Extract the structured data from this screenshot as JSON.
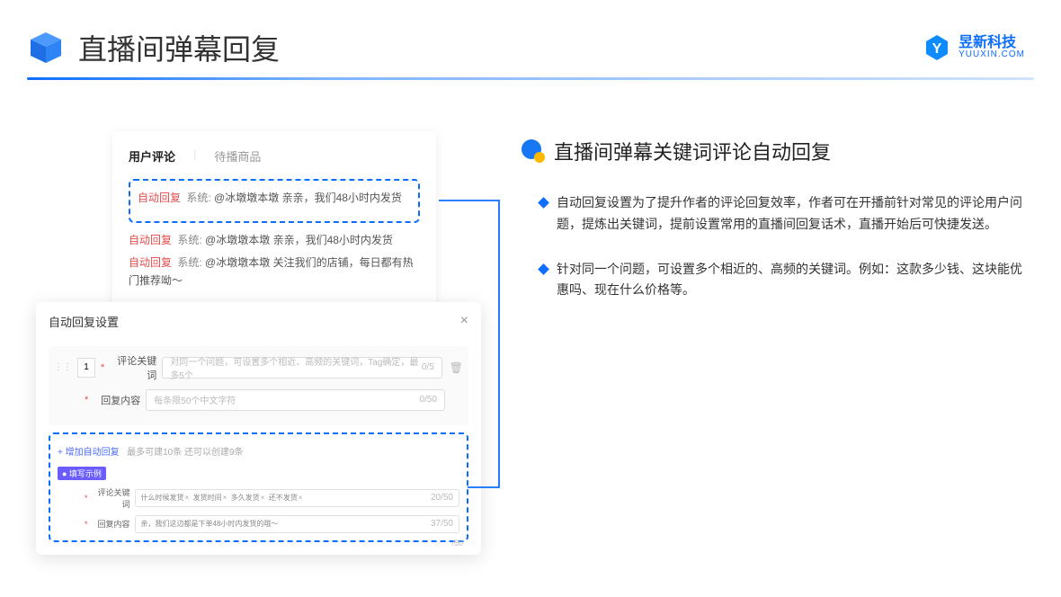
{
  "header": {
    "title": "直播间弹幕回复",
    "brand_cn": "昱新科技",
    "brand_en": "YUUXIN.COM"
  },
  "comments_card": {
    "tab_active": "用户评论",
    "tab_inactive": "待播商品",
    "highlighted": {
      "tag": "自动回复",
      "prefix": "系统:",
      "text": "@冰墩墩本墩 亲亲，我们48小时内发货"
    },
    "rows": [
      {
        "tag": "自动回复",
        "prefix": "系统:",
        "text": "@冰墩墩本墩 亲亲，我们48小时内发货"
      },
      {
        "tag": "自动回复",
        "prefix": "系统:",
        "text": "@冰墩墩本墩 关注我们的店铺，每日都有热门推荐呦～"
      }
    ]
  },
  "settings_card": {
    "title": "自动回复设置",
    "index": "1",
    "label_keyword": "评论关键词",
    "placeholder_keyword": "对同一个问题，可设置多个相近、高频的关键词，Tag确定，最多5个",
    "count_keyword": "0/5",
    "label_content": "回复内容",
    "placeholder_content": "每条限50个中文字符",
    "count_content": "0/50",
    "add_link": "+ 增加自动回复",
    "add_hint": "最多可建10条 还可以创建9条",
    "example_badge": "● 填写示例",
    "example_label_keyword": "评论关键词",
    "example_chips": [
      "什么时候发货",
      "发货时间",
      "多久发货",
      "还不发货"
    ],
    "example_count_keyword": "20/50",
    "example_label_content": "回复内容",
    "example_content": "亲，我们这边都是下单48小时内发货的哦～",
    "example_count_content": "37/50",
    "below_count": "/50"
  },
  "right": {
    "section_title": "直播间弹幕关键词评论自动回复",
    "bullets": [
      "自动回复设置为了提升作者的评论回复效率，作者可在开播前针对常见的评论用户问题，提炼出关键词，提前设置常用的直播间回复话术，直播开始后可快捷发送。",
      "针对同一个问题，可设置多个相近的、高频的关键词。例如：这款多少钱、这块能优惠吗、现在什么价格等。"
    ]
  }
}
